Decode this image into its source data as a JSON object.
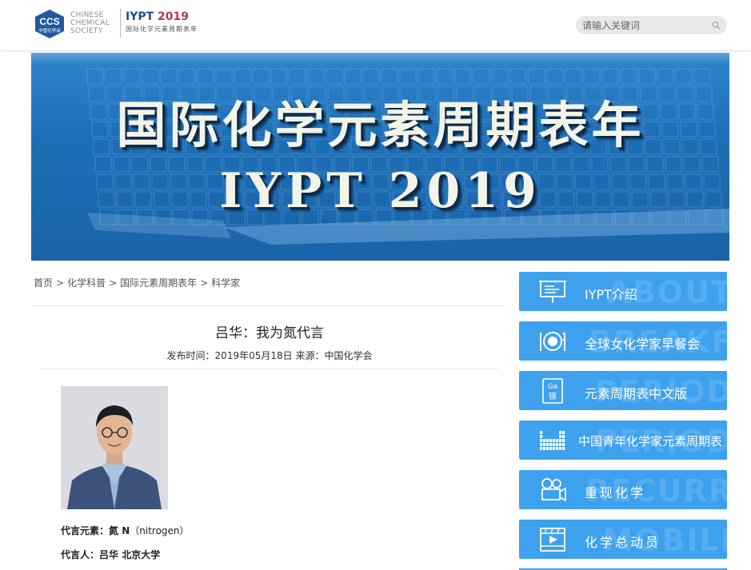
{
  "header": {
    "logo_abbr": "CCS",
    "logo_cn": "中国化学会",
    "logo_line1": "CHINESE",
    "logo_line2": "CHEMICAL",
    "logo_line3": "SOCIETY",
    "iypt_part1": "IYPT",
    "iypt_part2": "2019",
    "iypt_sub": "国际化学元素周期表年",
    "search_placeholder": "请输入关键词"
  },
  "banner": {
    "title": "国际化学元素周期表年",
    "subtitle": "IYPT 2019"
  },
  "breadcrumb": [
    "首页",
    "化学科普",
    "国际元素周期表年",
    "科学家"
  ],
  "breadcrumb_sep": ">",
  "article": {
    "title": "吕华：我为氮代言",
    "meta": "发布时间：2019年05月18日 来源：中国化学会",
    "element_label": "代言元素：",
    "element_value": "氮 N",
    "element_en": "（nitrogen）",
    "person_label": "代言人：",
    "person_value": "吕华  北京大学"
  },
  "sidebar": [
    {
      "label": "IYPT介绍",
      "watermark": "ABOUT",
      "icon": "presentation-board-icon"
    },
    {
      "label": "全球女化学家早餐会",
      "watermark": "BREAKF",
      "icon": "breakfast-plate-icon"
    },
    {
      "label": "元素周期表中文版",
      "watermark": "PERIOD",
      "icon": "element-card-icon",
      "icon_text1": "Ga",
      "icon_text2": "镓"
    },
    {
      "label": "中国青年化学家元素周期表",
      "watermark": "PERIOD",
      "icon": "periodic-grid-icon"
    },
    {
      "label": "重现化学",
      "watermark": "RECURR",
      "icon": "film-camera-icon"
    },
    {
      "label": "化学总动员",
      "watermark": "MOBILI",
      "icon": "video-play-icon"
    }
  ],
  "colors": {
    "accent": "#3da1ee",
    "banner": "#1e6fb8",
    "iypt_blue": "#1f4f8f",
    "iypt_red": "#b3375a"
  }
}
